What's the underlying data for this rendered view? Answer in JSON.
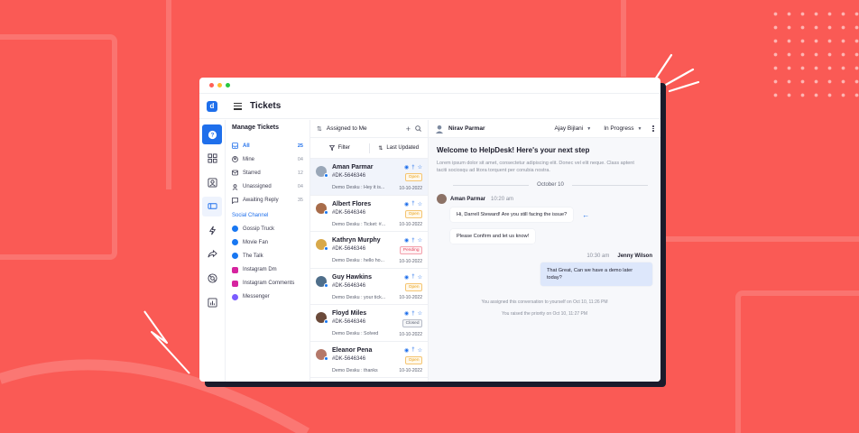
{
  "window": {
    "dots": [
      "#ff5f57",
      "#ffbd2e",
      "#28c840"
    ]
  },
  "app": {
    "title": "Tickets",
    "logo": "d"
  },
  "rail": {
    "items": [
      "help-icon",
      "dashboard-icon",
      "contacts-icon",
      "tickets-icon",
      "automation-icon",
      "share-icon",
      "support-icon",
      "reports-icon"
    ]
  },
  "manage": {
    "title": "Manage Tickets",
    "items": [
      {
        "label": "All",
        "count": "25",
        "icon": "inbox-icon"
      },
      {
        "label": "Mine",
        "count": "04",
        "icon": "user-icon"
      },
      {
        "label": "Starred",
        "count": "12",
        "icon": "star-icon"
      },
      {
        "label": "Unassigned",
        "count": "04",
        "icon": "person-icon"
      },
      {
        "label": "Awaiting Reply",
        "count": "35",
        "icon": "chat-icon"
      }
    ],
    "social_title": "Social Channel",
    "channels": [
      {
        "label": "Gossip Truck",
        "color": "#1877f2"
      },
      {
        "label": "Movie Fan",
        "color": "#1877f2"
      },
      {
        "label": "The Talk",
        "color": "#1877f2"
      },
      {
        "label": "Instagram Dm",
        "color": "#d6249f"
      },
      {
        "label": "Instagram Comments",
        "color": "#d6249f"
      },
      {
        "label": "Messenger",
        "color": "#7b5cff"
      }
    ]
  },
  "tickets": {
    "header": "Assigned to Me",
    "filter_label": "Filter",
    "sort_label": "Last Updated",
    "items": [
      {
        "name": "Aman Parmar",
        "id": "#DK-5646346",
        "subject": "Demo Desku : Hey it is...",
        "date": "10-10-2022",
        "status": "Open",
        "status_class": "open",
        "avatar": "#9aa7b8"
      },
      {
        "name": "Albert Flores",
        "id": "#DK-5646346",
        "subject": "Demo Desku : Ticket: #...",
        "date": "10-10-2022",
        "status": "Open",
        "status_class": "open",
        "avatar": "#a86c4a"
      },
      {
        "name": "Kathryn Murphy",
        "id": "#DK-5646346",
        "subject": "Demo Desku : hello ho...",
        "date": "10-10-2022",
        "status": "Pending",
        "status_class": "pending",
        "avatar": "#d8a94a"
      },
      {
        "name": "Guy Hawkins",
        "id": "#DK-5646346",
        "subject": "Demo Desku : your tick...",
        "date": "10-10-2022",
        "status": "Open",
        "status_class": "open",
        "avatar": "#4f6e8a"
      },
      {
        "name": "Floyd Miles",
        "id": "#DK-5646346",
        "subject": "Demo Desku : Solved",
        "date": "10-10-2022",
        "status": "Closed",
        "status_class": "closed",
        "avatar": "#6b4a3a"
      },
      {
        "name": "Eleanor Pena",
        "id": "#DK-5646346",
        "subject": "Demo Desku : thanks",
        "date": "10-10-2022",
        "status": "Open",
        "status_class": "open",
        "avatar": "#b5796a"
      }
    ]
  },
  "conversation": {
    "contact": "Nirav Parmar",
    "agent": "Ajay Bijlani",
    "status": "In Progress",
    "welcome": "Welcome to HelpDesk! Here's your next step",
    "intro": "Lorem ipsum dolor sit amet, consectetur adipiscing elit. Donec vel elit neque. Class aptent taciti sociosqu ad litora torquent per conubia nostra.",
    "date": "October 10",
    "incoming": {
      "name": "Aman Parmar",
      "time": "10:20 am",
      "lines": [
        "Hi, Darrell Steward! Are you still facing the issue?",
        "Please Confirm and let us know!"
      ]
    },
    "outgoing": {
      "name": "Jenny Wilson",
      "time": "10:30 am",
      "text": "That Great, Can we have a demo later today?"
    },
    "system": [
      "You assigned this conversation to yourself on Oct 10, 11:26 PM",
      "You raised the priority on Oct 10, 11:27 PM"
    ]
  }
}
